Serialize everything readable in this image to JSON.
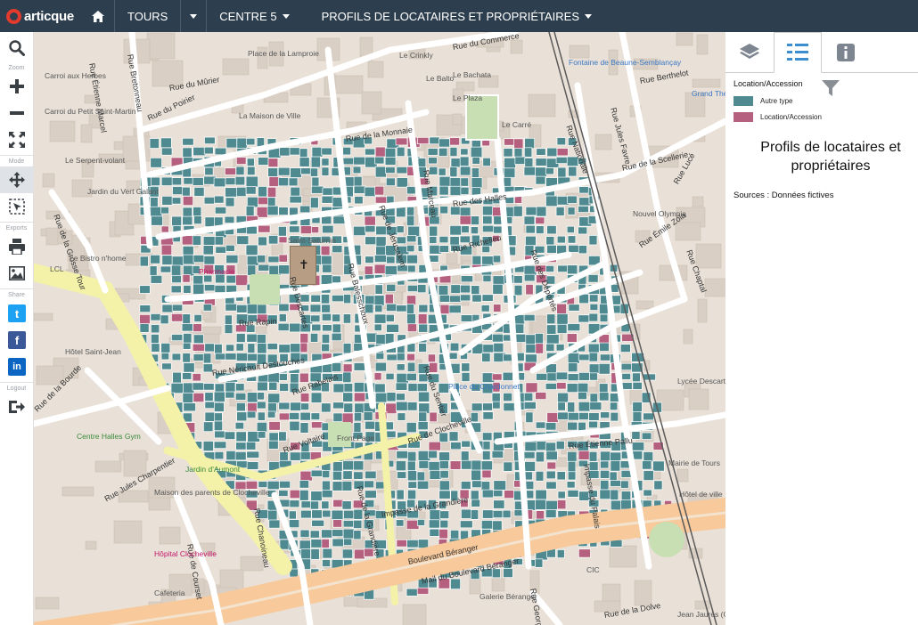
{
  "app": {
    "logo_text": "articque"
  },
  "topbar": {
    "home_icon": "home-icon",
    "city": "TOURS",
    "zone": "CENTRE 5",
    "map_title": "PROFILS DE LOCATAIRES ET PROPRIÉTAIRES"
  },
  "toolbar": {
    "zoom_label": "Zoom",
    "mode_label": "Mode",
    "exports_label": "Exports",
    "share_label": "Share",
    "logout_label": "Logout",
    "twitter_glyph": "t",
    "facebook_glyph": "f",
    "linkedin_glyph": "in"
  },
  "legend": {
    "heading": "Location/Accession",
    "items": [
      {
        "label": "Autre type",
        "color": "#4f8a91"
      },
      {
        "label": "Location/Accession",
        "color": "#b5607f"
      }
    ]
  },
  "panel": {
    "title": "Profils de locataires et propriétaires",
    "sources": "Sources : Données fictives"
  },
  "colors": {
    "topbar": "#2d3e4e",
    "autre_type": "#4f8a91",
    "location_accession": "#b5607f",
    "pedestrian": "#f4f1a9",
    "boulevard": "#f7c99b"
  },
  "map": {
    "streets": [
      "Rue Bretonneau",
      "Rue du Mûrier",
      "Rue du Poirier",
      "Rue de la Monnaie",
      "Rue Berthelot",
      "Rue de la Scellerie",
      "Rue des Halles",
      "Rue de Jérusalem",
      "Rue Richelieu",
      "Rue des Déportés",
      "Rue Émile Zola",
      "Rue Chaptal",
      "Rue Nationale",
      "Rue Jules Favre",
      "Rue du Commerce",
      "Rue Marceau",
      "Rue Descartes",
      "Rue Balesschoux",
      "Rue Néricault Destouches",
      "Rue Rabelais",
      "Rue de Clocheville",
      "Rue du Sentier",
      "Rue Étienne Pallu",
      "Rue de la Bourde",
      "Rue Jules Charpentier",
      "Rue Chanoineau",
      "Rue de la Grandière",
      "Impasse de la Grandière",
      "Impasse du Palais",
      "Rue Voltaire",
      "Rue de Courset",
      "Boulevard Béranger",
      "Mail du Boulevard Béranger",
      "Rue de la Dolve",
      "Rue George Sand",
      "Rue de la Grosse Tour",
      "Rue Étienne Marcel",
      "Rue Lucé",
      "Rue Rapin"
    ],
    "places": [
      "Carroi aux Herbes",
      "Carroi du Petit Saint-Martin",
      "Jardin du Vert Galant",
      "Le Bistro n'home",
      "LCL",
      "Hôtel Saint-Jean",
      "Centre Halles Gym",
      "Maison des parents de Clocheville",
      "Hôpital Clocheville",
      "Cafeteria",
      "Jardin d'Aumont",
      "Place du Chardonnet",
      "Lycée Descartes",
      "Nouvel Olympia",
      "Fontaine de Beaune-Semblançay",
      "Place de la Lamproie",
      "Hôtel de ville",
      "Mairie de Tours",
      "Jean Jaurès (Grammont)",
      "Galerie Béranger",
      "Le Crinkly",
      "Le Plaza",
      "Le Balto",
      "Le Bachata",
      "La Maison de Ville",
      "Le Serpent-volant",
      "Pharmacie",
      "Saint-Saturnin",
      "Front Page",
      "Grand Théâtre",
      "CIC",
      "Le Carré"
    ]
  }
}
